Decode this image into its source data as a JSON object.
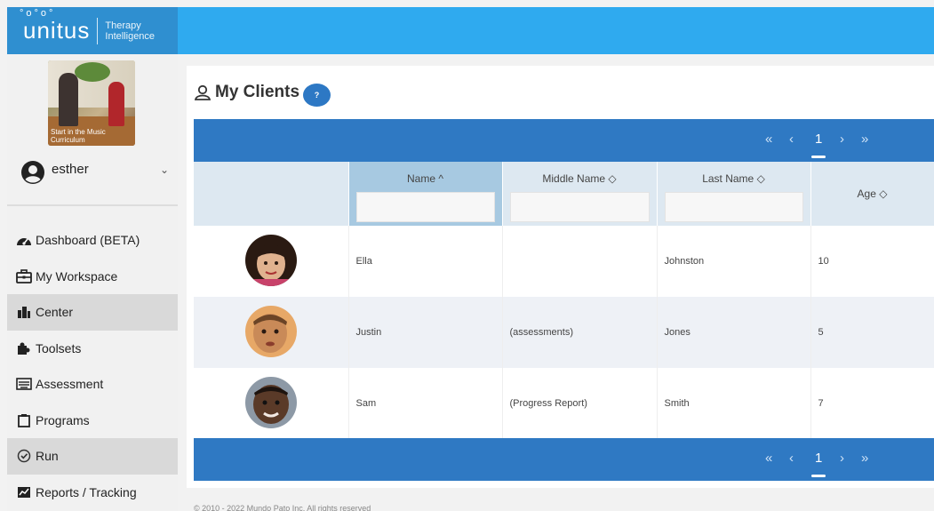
{
  "brand": {
    "name": "unitus",
    "dots": "°o°o°",
    "subtitle_line1": "Therapy",
    "subtitle_line2": "Intelligence"
  },
  "sidebar": {
    "photo_caption": "Start in the Music Curriculum",
    "user": {
      "name": "esther"
    },
    "items": [
      {
        "label": "Dashboard (BETA)",
        "icon": "dashboard-icon",
        "active": false
      },
      {
        "label": "My Workspace",
        "icon": "briefcase-icon",
        "active": false
      },
      {
        "label": "Center",
        "icon": "building-icon",
        "active": true
      },
      {
        "label": "Toolsets",
        "icon": "puzzle-icon",
        "active": false
      },
      {
        "label": "Assessment",
        "icon": "keyboard-icon",
        "active": false
      },
      {
        "label": "Programs",
        "icon": "clipboard-icon",
        "active": false
      },
      {
        "label": "Run",
        "icon": "check-circle-icon",
        "active": true
      },
      {
        "label": "Reports / Tracking",
        "icon": "chart-icon",
        "active": false
      }
    ]
  },
  "main": {
    "title": "My Clients",
    "help": "?"
  },
  "pager": {
    "first": "«",
    "prev": "‹",
    "current": "1",
    "next": "›",
    "last": "»"
  },
  "table": {
    "columns": {
      "name": "Name ^",
      "middle": "Middle Name ◇",
      "last": "Last Name ◇",
      "age": "Age ◇"
    },
    "rows": [
      {
        "first": "Ella",
        "middle": "",
        "last": "Johnston",
        "age": "10",
        "avatar_skin": "#e0b28f",
        "avatar_hair": "#2a1a12"
      },
      {
        "first": "Justin",
        "middle": "(assessments)",
        "last": "Jones",
        "age": "5",
        "avatar_skin": "#c98a58",
        "avatar_hair": "#6b4426"
      },
      {
        "first": "Sam",
        "middle": "(Progress Report)",
        "last": "Smith",
        "age": "7",
        "avatar_skin": "#5a3a28",
        "avatar_hair": "#1e140f"
      }
    ]
  },
  "footer": {
    "text": "© 2010 - 2022 Mundo Pato Inc. All rights reserved"
  }
}
